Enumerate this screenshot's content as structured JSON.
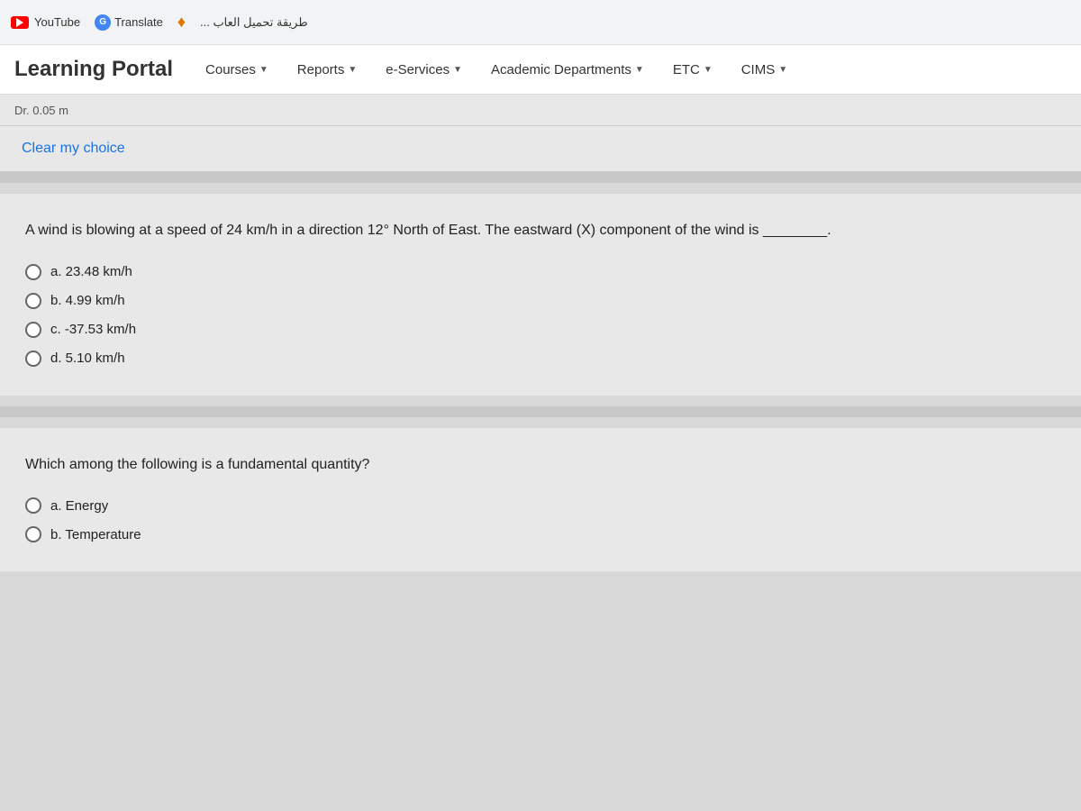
{
  "browser": {
    "youtube_label": "YouTube",
    "translate_label": "Translate",
    "arabic_text": "طريقة تحميل العاب ...",
    "bookmark_char": "♦"
  },
  "navbar": {
    "title": "Learning Portal",
    "courses_label": "Courses",
    "reports_label": "Reports",
    "eservices_label": "e-Services",
    "academic_label": "Academic Departments",
    "etc_label": "ETC",
    "cims_label": "CIMS"
  },
  "subheader": {
    "user_info": "Dr.   0.05 m"
  },
  "clear_choice": {
    "label": "Clear my choice"
  },
  "question1": {
    "text": "A wind is blowing at a speed of 24 km/h in a direction 12° North of East. The eastward (X) component of the wind is ________.",
    "options": [
      {
        "label": "a. 23.48 km/h",
        "id": "q1a"
      },
      {
        "label": "b. 4.99 km/h",
        "id": "q1b"
      },
      {
        "label": "c. -37.53 km/h",
        "id": "q1c"
      },
      {
        "label": "d. 5.10 km/h",
        "id": "q1d"
      }
    ]
  },
  "question2": {
    "text": "Which among the following is a fundamental quantity?",
    "options": [
      {
        "label": "a.  Energy",
        "id": "q2a"
      },
      {
        "label": "b.  Temperature",
        "id": "q2b"
      }
    ]
  }
}
